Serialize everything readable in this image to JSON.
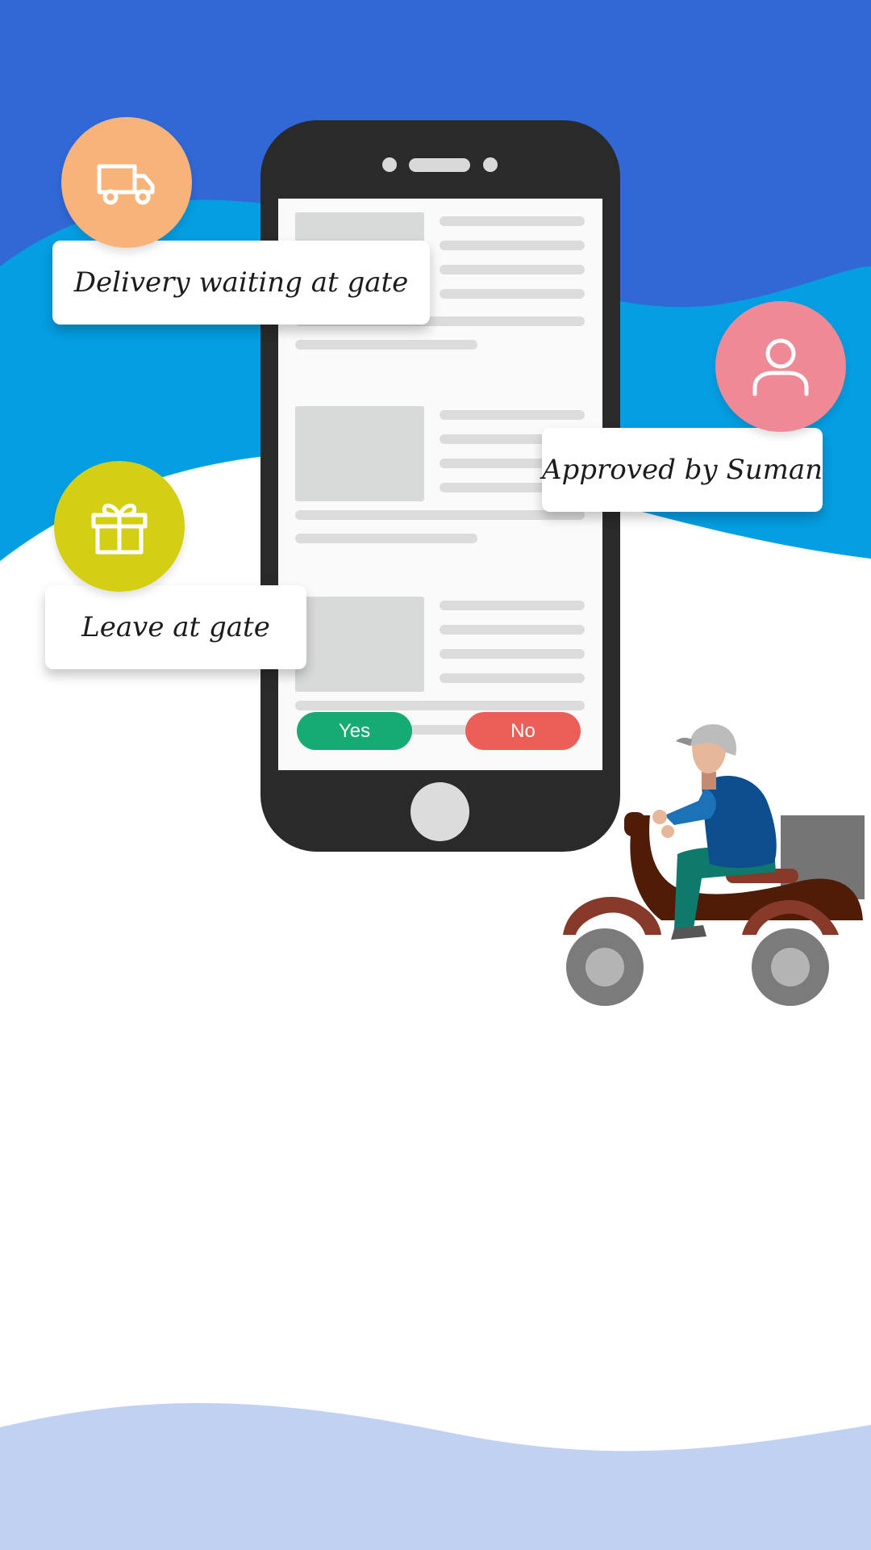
{
  "notifications": [
    {
      "id": "delivery",
      "text": "Delivery waiting at gate",
      "icon": "truck-icon",
      "color": "#f7b37a"
    },
    {
      "id": "approved",
      "text": "Approved by Suman",
      "icon": "user-icon",
      "color": "#f08996"
    },
    {
      "id": "leave",
      "text": "Leave at gate",
      "icon": "gift-icon",
      "color": "#d3cf14"
    }
  ],
  "phone": {
    "buttons": {
      "yes": "Yes",
      "no": "No"
    },
    "yes_color": "#17ab74",
    "no_color": "#ec5e58"
  },
  "colors": {
    "background_top": "#3168d6",
    "background_wave": "#049ee2",
    "footer_wave": "#c0d1f1"
  }
}
